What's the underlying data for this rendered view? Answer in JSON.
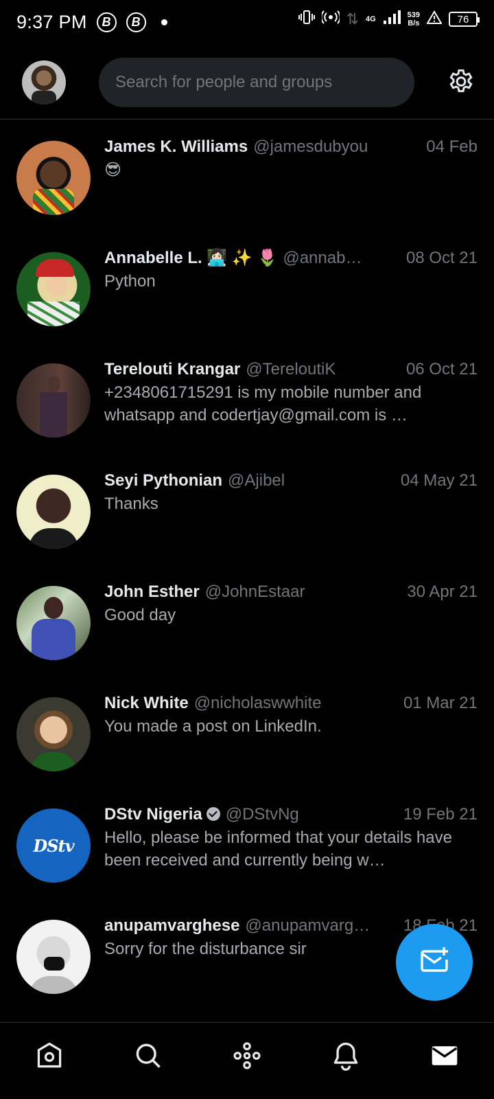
{
  "status_bar": {
    "time": "9:37 PM",
    "b_badge_1": "B",
    "b_badge_2": "B",
    "network_type": "4G",
    "speed_value": "539",
    "speed_unit": "B/s",
    "battery": "76"
  },
  "header": {
    "search_placeholder": "Search for people and groups"
  },
  "conversations": [
    {
      "name": "James K. Williams",
      "handle": "@jamesdubyou",
      "date": "04 Feb",
      "message": "😎",
      "verified": false
    },
    {
      "name": "Annabelle L. 👩🏻‍💻 ✨ 🌷",
      "handle": "@annab…",
      "date": "08 Oct 21",
      "message": "Python",
      "verified": false
    },
    {
      "name": "Terelouti Krangar",
      "handle": "@TereloutiK",
      "date": "06 Oct 21",
      "message": "+2348061715291 is my mobile number and whatsapp  and  codertjay@gmail.com is …",
      "verified": false
    },
    {
      "name": "Seyi Pythonian",
      "handle": "@Ajibel",
      "date": "04 May 21",
      "message": "Thanks",
      "verified": false
    },
    {
      "name": "John Esther",
      "handle": "@JohnEstaar",
      "date": "30 Apr 21",
      "message": "Good day",
      "verified": false
    },
    {
      "name": "Nick White",
      "handle": "@nicholaswwhite",
      "date": "01 Mar 21",
      "message": "You made a post on LinkedIn.",
      "verified": false
    },
    {
      "name": "DStv Nigeria",
      "handle": "@DStvNg",
      "date": "19 Feb 21",
      "message": "Hello, please be informed that your details have been received and currently being w…",
      "verified": true,
      "logo_text": "DStv"
    },
    {
      "name": "anupamvarghese",
      "handle": "@anupamvarg…",
      "date": "18 Feb 21",
      "message": "Sorry for the disturbance sir",
      "verified": false
    }
  ],
  "colors": {
    "accent": "#1d9bf0",
    "background": "#000000",
    "secondary_text": "#71767b"
  },
  "icons": {
    "settings": "gear-icon",
    "compose": "new-message-icon",
    "nav": [
      "home-icon",
      "search-icon",
      "spaces-icon",
      "notifications-icon",
      "messages-icon"
    ]
  }
}
